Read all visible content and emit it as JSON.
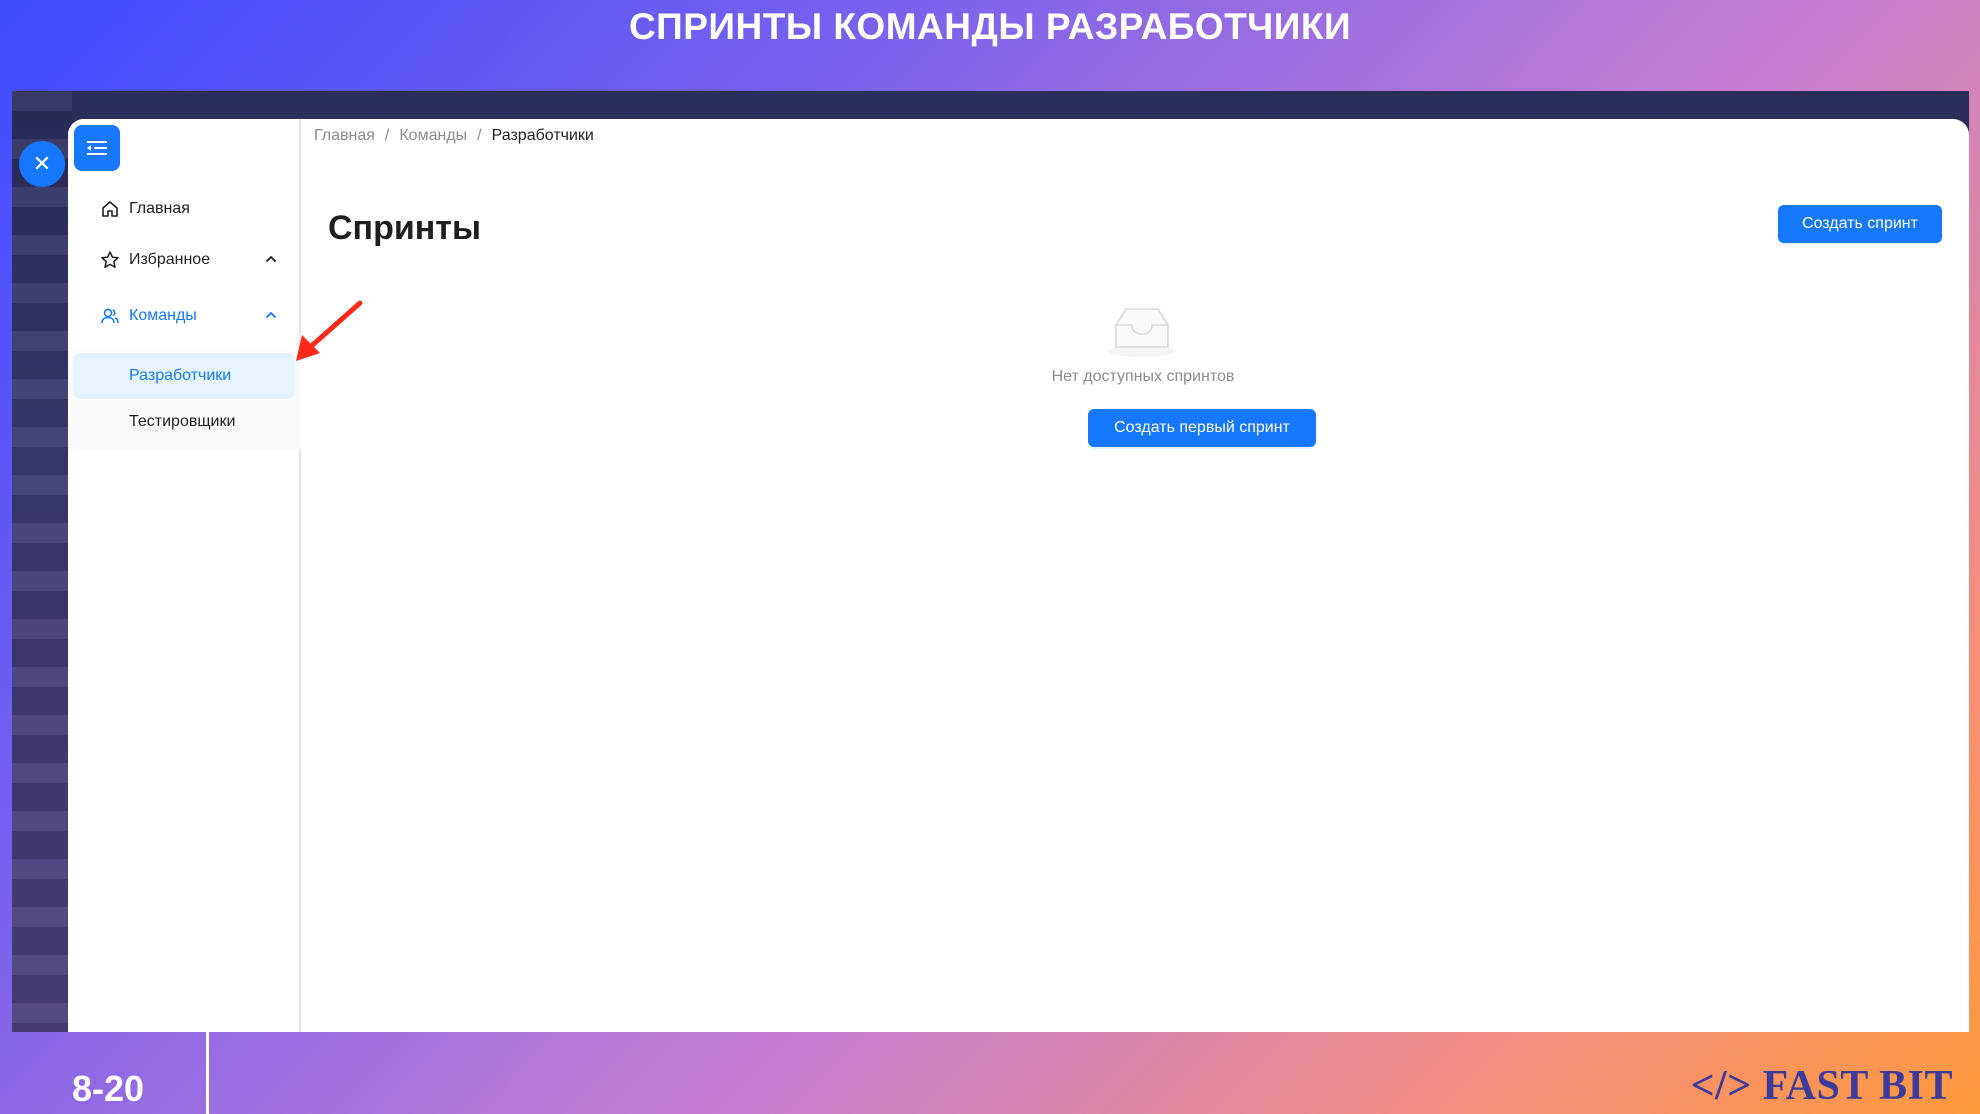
{
  "slide": {
    "title": "СПРИНТЫ КОМАНДЫ РАЗРАБОТЧИКИ",
    "page_number": "8-20",
    "logo": "</> FAST BIT"
  },
  "breadcrumb": {
    "items": [
      "Главная",
      "Команды"
    ],
    "separator": "/",
    "current": "Разработчики"
  },
  "sidebar": {
    "items": [
      {
        "label": "Главная",
        "icon": "home-icon"
      },
      {
        "label": "Избранное",
        "icon": "star-icon",
        "expanded": true
      },
      {
        "label": "Команды",
        "icon": "team-icon",
        "expanded": true,
        "active": true
      }
    ],
    "subitems": [
      {
        "label": "Разработчики",
        "selected": true
      },
      {
        "label": "Тестировщики",
        "selected": false
      }
    ]
  },
  "main": {
    "title": "Спринты",
    "create_button": "Создать спринт",
    "empty_text": "Нет доступных спринтов",
    "create_first_button": "Создать первый спринт"
  },
  "colors": {
    "primary": "#1677ff",
    "selected_bg": "#e6f4ff",
    "annotation_arrow": "#ff2a1a"
  }
}
